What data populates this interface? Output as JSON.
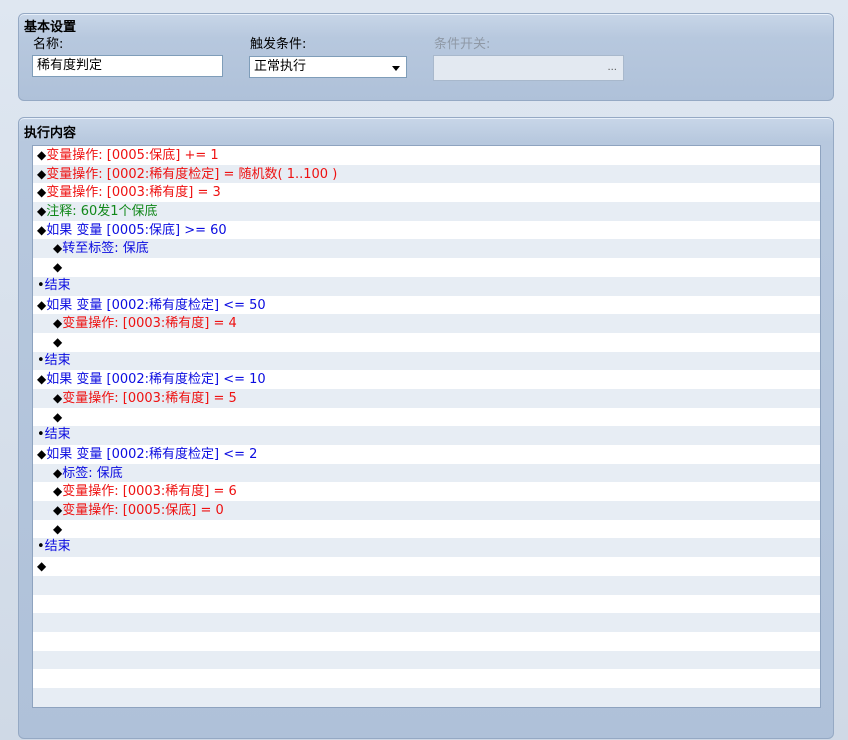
{
  "basic_settings": {
    "title": "基本设置",
    "name_label": "名称:",
    "name_value": "稀有度判定",
    "trigger_label": "触发条件:",
    "trigger_value": "正常执行",
    "switch_label": "条件开关:",
    "switch_button": "..."
  },
  "exec_content": {
    "title": "执行内容",
    "lines": [
      {
        "indent": 0,
        "marker": "◆",
        "text": "变量操作: [0005:保底] += 1",
        "color": "red"
      },
      {
        "indent": 0,
        "marker": "◆",
        "text": "变量操作: [0002:稀有度检定] = 随机数( 1..100 )",
        "color": "red"
      },
      {
        "indent": 0,
        "marker": "◆",
        "text": "变量操作: [0003:稀有度] = 3",
        "color": "red"
      },
      {
        "indent": 0,
        "marker": "◆",
        "text": "注释: 60发1个保底",
        "color": "green"
      },
      {
        "indent": 0,
        "marker": "◆",
        "text": "如果 变量 [0005:保底] >= 60",
        "color": "blue"
      },
      {
        "indent": 1,
        "marker": "◆",
        "text": "转至标签: 保底",
        "color": "blue"
      },
      {
        "indent": 1,
        "marker": "◆",
        "text": "",
        "color": "black"
      },
      {
        "indent": 0,
        "marker": "•",
        "text": "结束",
        "color": "blue"
      },
      {
        "indent": 0,
        "marker": "◆",
        "text": "如果 变量 [0002:稀有度检定] <= 50",
        "color": "blue"
      },
      {
        "indent": 1,
        "marker": "◆",
        "text": "变量操作: [0003:稀有度] = 4",
        "color": "red"
      },
      {
        "indent": 1,
        "marker": "◆",
        "text": "",
        "color": "black"
      },
      {
        "indent": 0,
        "marker": "•",
        "text": "结束",
        "color": "blue"
      },
      {
        "indent": 0,
        "marker": "◆",
        "text": "如果 变量 [0002:稀有度检定] <= 10",
        "color": "blue"
      },
      {
        "indent": 1,
        "marker": "◆",
        "text": "变量操作: [0003:稀有度] = 5",
        "color": "red"
      },
      {
        "indent": 1,
        "marker": "◆",
        "text": "",
        "color": "black"
      },
      {
        "indent": 0,
        "marker": "•",
        "text": "结束",
        "color": "blue"
      },
      {
        "indent": 0,
        "marker": "◆",
        "text": "如果 变量 [0002:稀有度检定] <= 2",
        "color": "blue"
      },
      {
        "indent": 1,
        "marker": "◆",
        "text": "标签: 保底",
        "color": "blue"
      },
      {
        "indent": 1,
        "marker": "◆",
        "text": "变量操作: [0003:稀有度] = 6",
        "color": "red"
      },
      {
        "indent": 1,
        "marker": "◆",
        "text": "变量操作: [0005:保底] = 0",
        "color": "red"
      },
      {
        "indent": 1,
        "marker": "◆",
        "text": "",
        "color": "black"
      },
      {
        "indent": 0,
        "marker": "•",
        "text": "结束",
        "color": "blue"
      },
      {
        "indent": 0,
        "marker": "◆",
        "text": "",
        "color": "black"
      }
    ],
    "total_rows": 30
  },
  "colors": {
    "red": "#ee1111",
    "blue": "#0b0ce0",
    "green": "#11881a",
    "black": "#000000"
  }
}
